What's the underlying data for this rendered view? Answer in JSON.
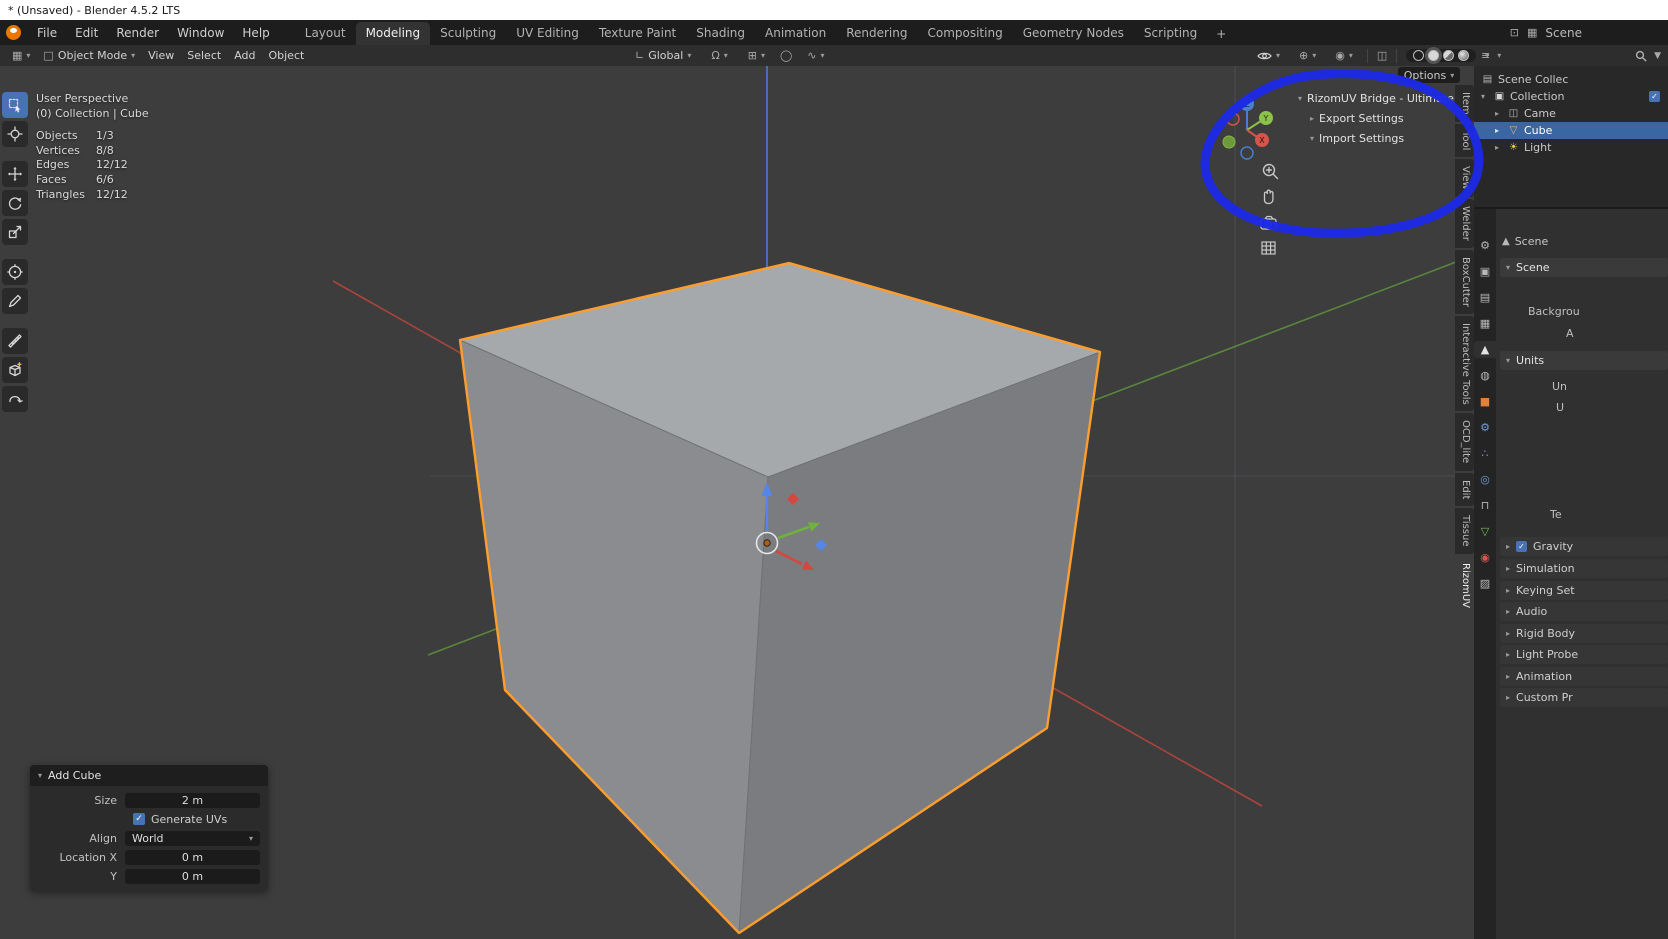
{
  "colors": {
    "accent": "#4772b3",
    "selection_outline": "#ff9e2c",
    "annotation_blue": "#1c2ae6",
    "axis_x": "#b8453c",
    "axis_y": "#5d8f3c",
    "axis_z": "#4a7fe0",
    "cube_top": "#a6a9ac",
    "cube_left": "#8a8c8f",
    "cube_right": "#7a7c7f",
    "outliner_selected": "#3a66a2"
  },
  "glyphs": {
    "caret_down": "▾",
    "caret_right": "▸",
    "check": "✓"
  },
  "icon_glyphs": {
    "tool": "⚙",
    "render": "▣",
    "output": "▤",
    "view_layer": "▦",
    "scene": "▲",
    "world": "◍",
    "object": "■",
    "modifiers": "⚙",
    "particles": "∴",
    "physics": "◎",
    "constraints": "⊓",
    "data": "▽",
    "material": "◉",
    "texture": "▨",
    "editor": "▦",
    "mode": "□",
    "orientation": "∟",
    "magnet": "Ω",
    "snap": "⊞",
    "prop_edit": "◯",
    "falloff": "∿",
    "gizmo": "⊕",
    "overlays": "◉",
    "xray": "◫",
    "list": "≡",
    "funnel": "▼",
    "display": "⊡",
    "image": "▦",
    "scene_collection": "▤",
    "collection": "▣",
    "camera": "◫",
    "mesh": "▽",
    "light": "☀"
  },
  "window": {
    "title": "* (Unsaved) - Blender 4.5.2 LTS"
  },
  "menubar": {
    "menus": [
      "File",
      "Edit",
      "Render",
      "Window",
      "Help"
    ],
    "workspaces": [
      "Layout",
      "Modeling",
      "Sculpting",
      "UV Editing",
      "Texture Paint",
      "Shading",
      "Animation",
      "Rendering",
      "Compositing",
      "Geometry Nodes",
      "Scripting"
    ],
    "active_workspace": "Modeling",
    "add_tab": "+",
    "scene_selector": "Scene"
  },
  "toolheader": {
    "mode": "Object Mode",
    "menus": [
      "View",
      "Select",
      "Add",
      "Object"
    ],
    "orientation": "Global"
  },
  "viewport": {
    "stats": {
      "view": "User Perspective",
      "context": "(0) Collection | Cube",
      "rows": [
        {
          "name": "Objects",
          "value": "1/3"
        },
        {
          "name": "Vertices",
          "value": "8/8"
        },
        {
          "name": "Edges",
          "value": "12/12"
        },
        {
          "name": "Faces",
          "value": "6/6"
        },
        {
          "name": "Triangles",
          "value": "12/12"
        }
      ]
    },
    "axis_labels": {
      "x": "X",
      "y": "Y",
      "z": "Z"
    },
    "options_button": "Options",
    "sidebar": {
      "title": "RizomUV Bridge  -  Ultimate Edi",
      "items": [
        "Export Settings",
        "Import Settings"
      ]
    },
    "tabs": [
      "Item",
      "Tool",
      "View",
      "Welder",
      "BoxCutter",
      "Interactive Tools",
      "OCD_lite",
      "Edit",
      "Tissue",
      "RizomUV"
    ],
    "active_tab": "RizomUV"
  },
  "operator_panel": {
    "title": "Add Cube",
    "size_label": "Size",
    "size_value": "2 m",
    "generate_uvs_label": "Generate UVs",
    "align_label": "Align",
    "align_value": "World",
    "location_x_label": "Location X",
    "location_x_value": "0 m",
    "location_y_label": "Y",
    "location_y_value": "0 m"
  },
  "outliner": {
    "rows": [
      {
        "label": "Scene Collec"
      },
      {
        "label": "Collection"
      },
      {
        "label": "Came"
      },
      {
        "label": "Cube"
      },
      {
        "label": "Light"
      }
    ]
  },
  "properties": {
    "breadcrumb": "Scene",
    "scene_panel": {
      "title": "Scene",
      "row1": "Backgrou",
      "row2": "A"
    },
    "units_panel": {
      "title": "Units",
      "row1": "Un",
      "row2": "U",
      "row3": "Te"
    },
    "collapsed": [
      {
        "label": "Gravity"
      },
      {
        "label": "Simulation"
      },
      {
        "label": "Keying Set"
      },
      {
        "label": "Audio"
      },
      {
        "label": "Rigid Body"
      },
      {
        "label": "Light Probe"
      },
      {
        "label": "Animation"
      },
      {
        "label": "Custom Pr"
      }
    ]
  }
}
